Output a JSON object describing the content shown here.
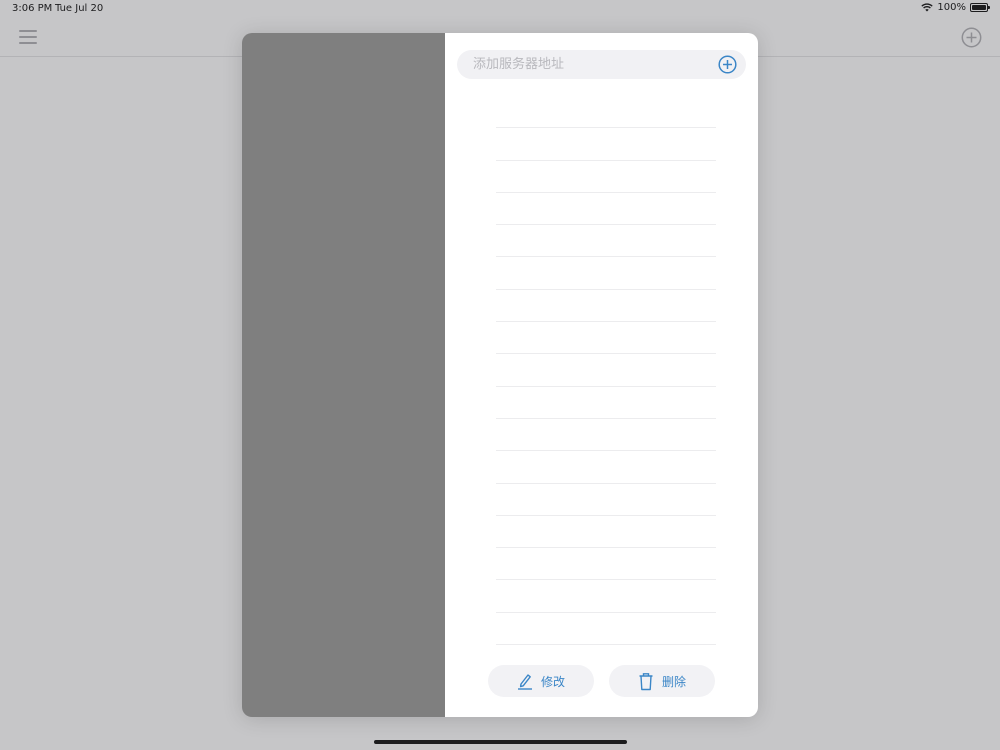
{
  "status_bar": {
    "time": "3:06 PM",
    "date": "Tue Jul 20",
    "battery": "100%"
  },
  "icons": {
    "menu": "hamburger-menu-icon",
    "add": "plus-circle-icon",
    "wifi": "wifi-icon",
    "battery": "battery-icon",
    "edit": "pencil-icon",
    "delete": "trash-icon"
  },
  "modal": {
    "search": {
      "value": "",
      "placeholder": "添加服务器地址"
    },
    "rows": [
      "",
      "",
      "",
      "",
      "",
      "",
      "",
      "",
      "",
      "",
      "",
      "",
      "",
      "",
      "",
      "",
      ""
    ],
    "buttons": {
      "edit_label": "修改",
      "delete_label": "删除"
    }
  },
  "colors": {
    "accent": "#3b86c7",
    "background": "#c6c6c8",
    "modal_left": "#7f7f7f"
  }
}
